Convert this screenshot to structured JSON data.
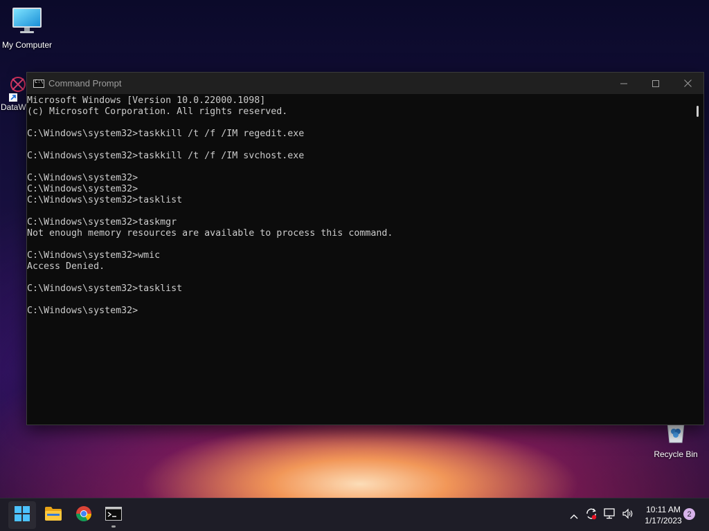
{
  "desktop": {
    "icons": [
      {
        "label": "My Computer",
        "icon": "monitor-icon"
      },
      {
        "label": "DataW",
        "icon": "datawiper-shortcut-icon"
      },
      {
        "label": "Recycle Bin",
        "icon": "recycle-bin-icon"
      }
    ]
  },
  "window": {
    "title": "Command Prompt",
    "controls": {
      "minimize": "minimize-icon",
      "maximize": "maximize-icon",
      "close": "close-icon"
    },
    "console_lines": [
      "Microsoft Windows [Version 10.0.22000.1098]",
      "(c) Microsoft Corporation. All rights reserved.",
      "",
      "C:\\Windows\\system32>taskkill /t /f /IM regedit.exe",
      "",
      "C:\\Windows\\system32>taskkill /t /f /IM svchost.exe",
      "",
      "C:\\Windows\\system32>",
      "C:\\Windows\\system32>",
      "C:\\Windows\\system32>tasklist",
      "",
      "C:\\Windows\\system32>taskmgr",
      "Not enough memory resources are available to process this command.",
      "",
      "C:\\Windows\\system32>wmic",
      "Access Denied.",
      "",
      "C:\\Windows\\system32>tasklist",
      "",
      "C:\\Windows\\system32>"
    ]
  },
  "taskbar": {
    "apps": [
      {
        "name": "Start",
        "icon": "windows-start-icon"
      },
      {
        "name": "File Explorer",
        "icon": "folder-icon"
      },
      {
        "name": "Google Chrome",
        "icon": "chrome-icon"
      },
      {
        "name": "Command Prompt",
        "icon": "terminal-icon",
        "active": true
      }
    ],
    "tray": {
      "icons": [
        "chevron-up-icon",
        "sync-icon",
        "network-icon",
        "volume-icon"
      ],
      "time": "10:11 AM",
      "date": "1/17/2023",
      "notification_count": "2"
    }
  },
  "colors": {
    "console_bg": "#0c0c0c",
    "console_text": "#cccccc",
    "titlebar_bg": "#202020",
    "taskbar_bg": "#1e1d27",
    "badge_bg": "#d7b3ea"
  }
}
